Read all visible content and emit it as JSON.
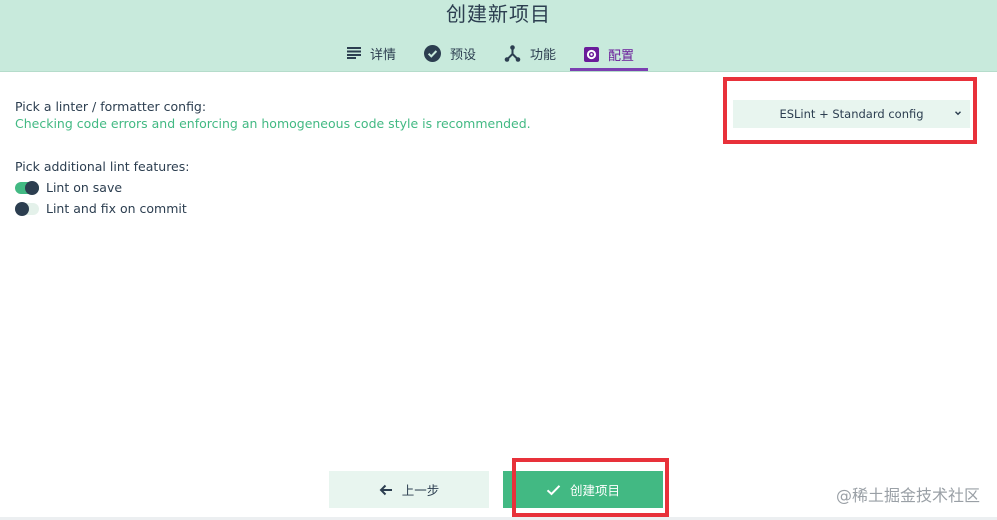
{
  "header": {
    "title": "创建新项目",
    "tabs": [
      {
        "label": "详情",
        "icon": "list-icon",
        "active": false
      },
      {
        "label": "预设",
        "icon": "check-circle-icon",
        "active": false
      },
      {
        "label": "功能",
        "icon": "fork-icon",
        "active": false
      },
      {
        "label": "配置",
        "icon": "gear-box-icon",
        "active": true
      }
    ]
  },
  "linter": {
    "title": "Pick a linter / formatter config:",
    "description": "Checking code errors and enforcing an homogeneous code style is recommended.",
    "selected": "ESLint + Standard config"
  },
  "features": {
    "title": "Pick additional lint features:",
    "items": [
      {
        "label": "Lint on save",
        "enabled": true
      },
      {
        "label": "Lint and fix on commit",
        "enabled": false
      }
    ]
  },
  "footer": {
    "prev_label": "上一步",
    "create_label": "创建项目"
  },
  "watermark": "@稀土掘金技术社区",
  "colors": {
    "header_bg": "#c8eadc",
    "accent_green": "#42b983",
    "active_tab": "#7b3fb1",
    "highlight_red": "#e8313a",
    "text_dark": "#2c3e50"
  }
}
